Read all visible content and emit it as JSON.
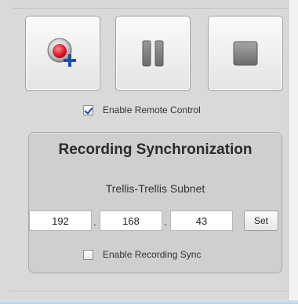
{
  "toolbar": {
    "record_icon": "record-add-icon",
    "pause_icon": "pause-icon",
    "stop_icon": "stop-icon"
  },
  "remote_control": {
    "label": "Enable Remote Control",
    "checked": true
  },
  "recording_sync": {
    "title": "Recording Synchronization",
    "subnet_label": "Trellis-Trellis Subnet",
    "ip_octets": [
      "192",
      "168",
      "43"
    ],
    "separator": ".",
    "set_label": "Set",
    "enable_label": "Enable Recording Sync",
    "enable_checked": false
  },
  "colors": {
    "record_red": "#e3283a",
    "plus_blue": "#1f4fa8",
    "panel_bg": "#d9d9d9"
  }
}
